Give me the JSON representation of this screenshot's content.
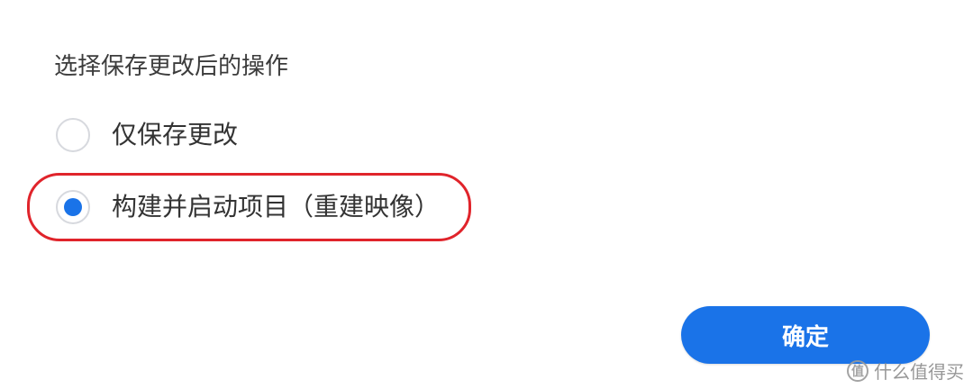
{
  "dialog": {
    "prompt": "选择保存更改后的操作",
    "options": [
      {
        "label": "仅保存更改",
        "selected": false
      },
      {
        "label": "构建并启动项目（重建映像）",
        "selected": true
      }
    ],
    "confirm_label": "确定"
  },
  "colors": {
    "accent": "#1a73e8",
    "highlight": "#e0242b"
  },
  "watermark": {
    "icon_glyph": "值",
    "text": "什么值得买"
  }
}
